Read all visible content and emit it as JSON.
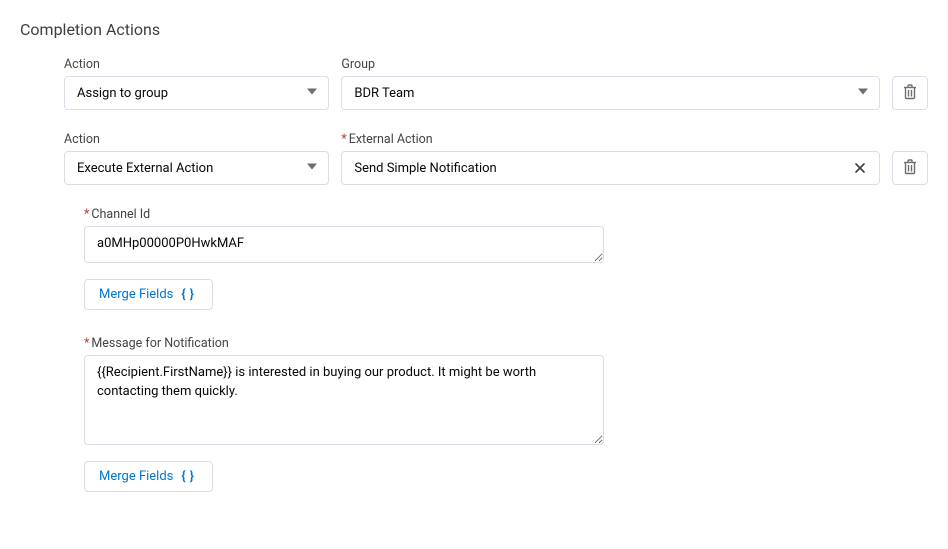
{
  "sectionTitle": "Completion Actions",
  "labels": {
    "action": "Action",
    "group": "Group",
    "externalAction": "External Action",
    "channelId": "Channel Id",
    "message": "Message for Notification",
    "mergeFields": "Merge Fields"
  },
  "row1": {
    "action": "Assign to group",
    "group": "BDR Team"
  },
  "row2": {
    "action": "Execute External Action",
    "externalAction": "Send Simple Notification"
  },
  "channelId": "a0MHp00000P0HwkMAF",
  "message": "{{Recipient.FirstName}} is interested in buying our product. It might be worth contacting them quickly."
}
